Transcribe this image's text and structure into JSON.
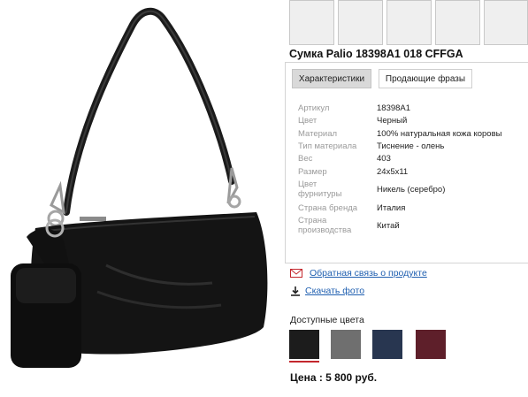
{
  "product": {
    "title": "Сумка Palio 18398A1 018 CFFGA"
  },
  "tabs": [
    {
      "label": "Характеристики",
      "active": true
    },
    {
      "label": "Продающие фразы",
      "active": false
    }
  ],
  "specs": [
    {
      "label": "Артикул",
      "value": "18398A1"
    },
    {
      "label": "Цвет",
      "value": "Черный"
    },
    {
      "label": "Материал",
      "value": "100% натуральная кожа коровы"
    },
    {
      "label": "Тип материала",
      "value": "Тиснение - олень"
    },
    {
      "label": "Вес",
      "value": "403"
    },
    {
      "label": "Размер",
      "value": "24x5x11"
    },
    {
      "label": "Цвет фурнитуры",
      "value": "Никель (серебро)"
    },
    {
      "label": "Страна бренда",
      "value": "Италия"
    },
    {
      "label": "Страна производства",
      "value": "Китай"
    }
  ],
  "links": {
    "feedback": "Обратная связь о продукте",
    "download": "Скачать фото"
  },
  "colors": {
    "label": "Доступные цвета",
    "swatches": [
      {
        "name": "black",
        "hex": "#1c1c1c"
      },
      {
        "name": "gray",
        "hex": "#6f6f6f"
      },
      {
        "name": "navy",
        "hex": "#283650"
      },
      {
        "name": "burgundy",
        "hex": "#5e1f2a"
      }
    ],
    "selected": 0,
    "selected_underline": "#c3272d"
  },
  "price": {
    "text": "Цена : 5 800 руб."
  },
  "accent": {
    "link": "#1f5fb0",
    "mail_icon": "#c3272d"
  }
}
